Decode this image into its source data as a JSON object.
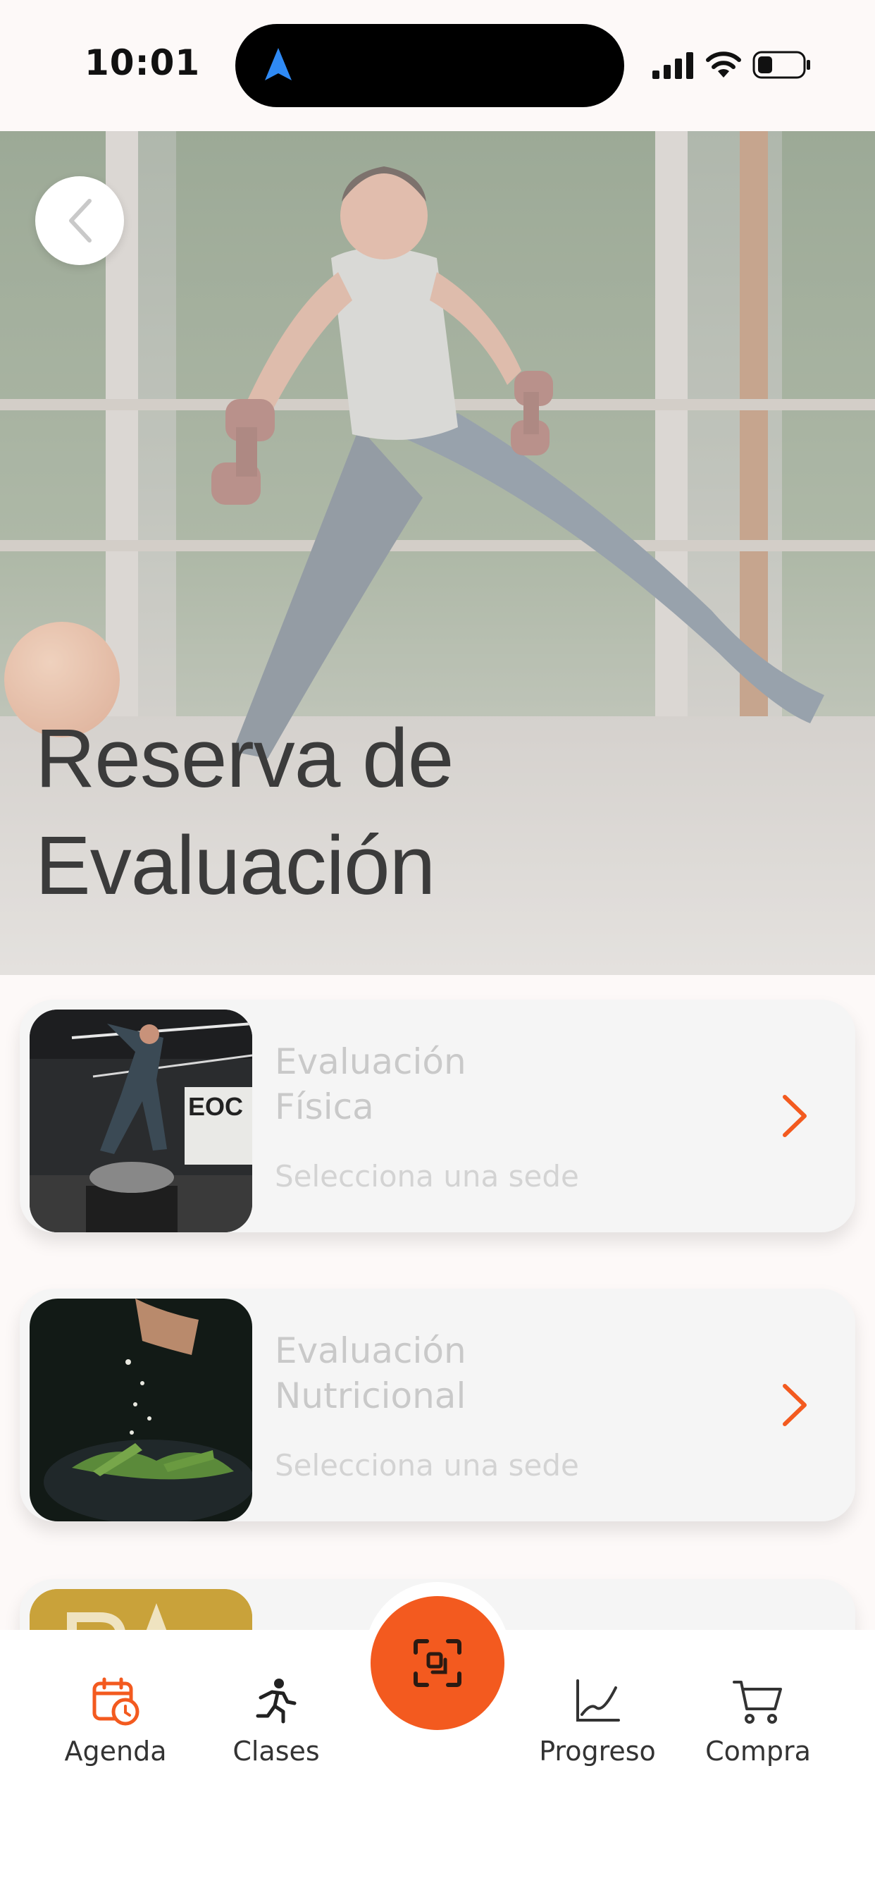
{
  "status_bar": {
    "time": "10:01"
  },
  "header": {
    "title_line1": "Reserva de",
    "title_line2": "Evaluación"
  },
  "cards": [
    {
      "title_line1": "Evaluación",
      "title_line2": "Física",
      "subtitle": "Selecciona una sede"
    },
    {
      "title_line1": "Evaluación",
      "title_line2": "Nutricional",
      "subtitle": "Selecciona una sede"
    }
  ],
  "bottom_nav": {
    "items": [
      {
        "label": "Agenda",
        "icon": "calendar-clock-icon",
        "active": true
      },
      {
        "label": "Clases",
        "icon": "running-person-icon",
        "active": false
      },
      {
        "label": "",
        "icon": "scan-icon",
        "active": false
      },
      {
        "label": "Progreso",
        "icon": "chart-line-icon",
        "active": false
      },
      {
        "label": "Compra",
        "icon": "cart-icon",
        "active": false
      }
    ]
  },
  "colors": {
    "accent": "#F35A1F",
    "background": "#FDF9F8",
    "card": "#F5F5F5"
  }
}
